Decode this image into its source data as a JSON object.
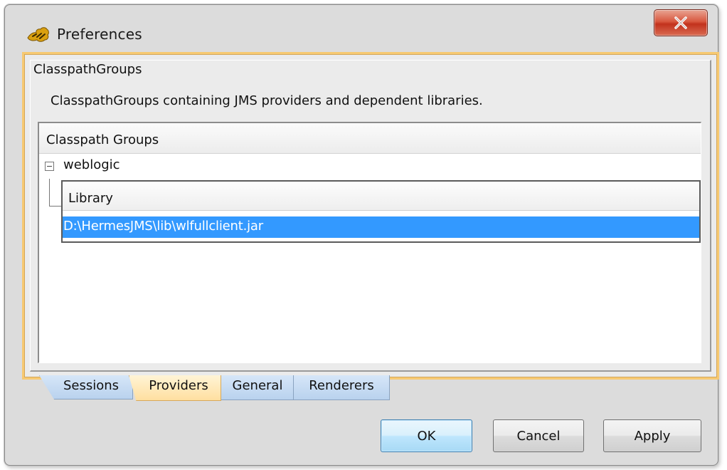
{
  "window": {
    "title": "Preferences",
    "close_icon": "close-icon"
  },
  "group": {
    "title": "ClasspathGroups",
    "description": "ClasspathGroups containing JMS providers and dependent libraries."
  },
  "tree": {
    "header": "Classpath Groups",
    "rows": [
      {
        "label": "weblogic",
        "expanded": true
      }
    ],
    "library_table": {
      "header": "Library",
      "rows": [
        {
          "value": "D:\\HermesJMS\\lib\\wlfullclient.jar",
          "selected": true
        }
      ]
    }
  },
  "tabs": [
    {
      "label": "Sessions",
      "active": false
    },
    {
      "label": "Providers",
      "active": true
    },
    {
      "label": "General",
      "active": false
    },
    {
      "label": "Renderers",
      "active": false
    }
  ],
  "buttons": {
    "ok": "OK",
    "cancel": "Cancel",
    "apply": "Apply"
  },
  "colors": {
    "selection": "#3399ff",
    "active_tab": "#ffdfa0",
    "frame_highlight": "#f7c972",
    "close_button": "#c2321d"
  }
}
